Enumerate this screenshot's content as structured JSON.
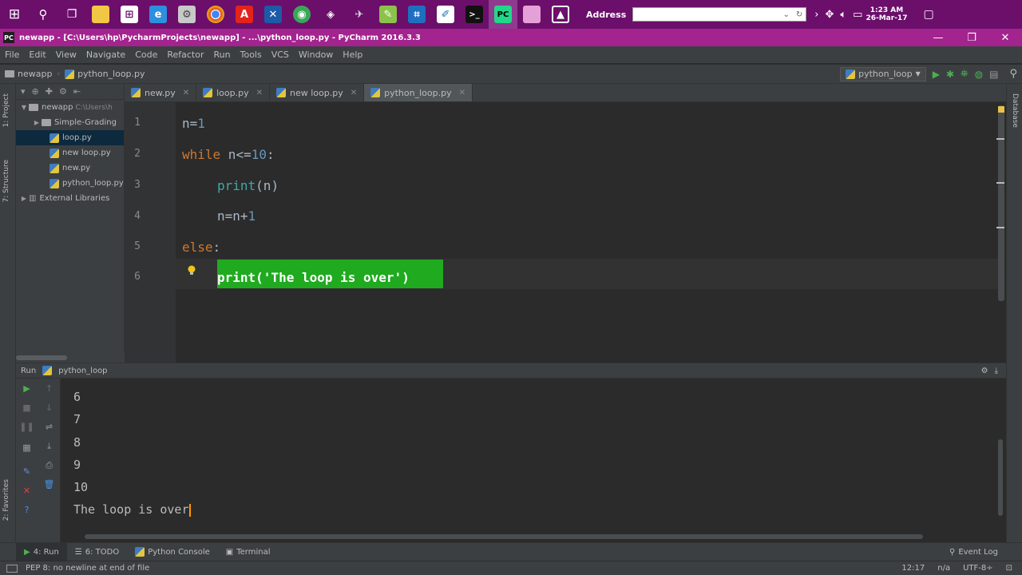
{
  "colors": {
    "taskbar": "#6b0f6b",
    "titlebar": "#a3238f",
    "ide_bg": "#2b2b2b",
    "panel_bg": "#3c3f41",
    "selection_highlight": "#1faa1f",
    "keyword": "#cc7832",
    "number": "#6897bb",
    "string": "#6a8759"
  },
  "taskbar": {
    "icons": [
      "windows-start-icon",
      "search-icon",
      "task-view-icon",
      "file-explorer-icon",
      "store-icon",
      "ie-icon",
      "settings-icon",
      "chrome-icon",
      "acrobat-icon",
      "network-icon",
      "android-icon",
      "unity-icon",
      "game-icon",
      "notepad-plus-icon",
      "screen-capture-icon",
      "pdf-edit-icon",
      "cmd-icon",
      "pycharm-icon",
      "paint-icon",
      "photos-icon"
    ],
    "address_label": "Address",
    "clock_time": "1:23 AM",
    "clock_date": "26-Mar-17"
  },
  "window": {
    "title": "newapp - [C:\\Users\\hp\\PycharmProjects\\newapp] - ...\\python_loop.py - PyCharm 2016.3.3"
  },
  "menu": [
    "File",
    "Edit",
    "View",
    "Navigate",
    "Code",
    "Refactor",
    "Run",
    "Tools",
    "VCS",
    "Window",
    "Help"
  ],
  "nav": {
    "project": "newapp",
    "file": "python_loop.py",
    "run_config": "python_loop"
  },
  "tool_stripe": {
    "project": "1: Project",
    "structure": "7: Structure",
    "favorites": "2: Favorites",
    "database": "Database"
  },
  "project_tree": [
    {
      "label": "newapp",
      "extra": "C:\\Users\\h",
      "depth": 0,
      "kind": "folder",
      "open": true
    },
    {
      "label": "Simple-Grading",
      "depth": 1,
      "kind": "folder",
      "open": false
    },
    {
      "label": "loop.py",
      "depth": 2,
      "kind": "py",
      "selected": true
    },
    {
      "label": "new loop.py",
      "depth": 2,
      "kind": "py"
    },
    {
      "label": "new.py",
      "depth": 2,
      "kind": "py"
    },
    {
      "label": "python_loop.py",
      "depth": 2,
      "kind": "py"
    },
    {
      "label": "External Libraries",
      "depth": 0,
      "kind": "lib",
      "open": false
    }
  ],
  "editor_tabs": [
    {
      "label": "new.py",
      "active": false
    },
    {
      "label": "loop.py",
      "active": false
    },
    {
      "label": "new loop.py",
      "active": false
    },
    {
      "label": "python_loop.py",
      "active": true
    }
  ],
  "code_lines": [
    "1",
    "2",
    "3",
    "4",
    "5",
    "6"
  ],
  "code": {
    "l1": {
      "a": "n=",
      "b": "1"
    },
    "l2": {
      "a": "while",
      "b": " n<=",
      "c": "10",
      "d": ":"
    },
    "l3": {
      "a": "print",
      "b": "(n)"
    },
    "l4": {
      "a": "n=n+",
      "b": "1"
    },
    "l5": {
      "a": "else",
      "b": ":"
    },
    "l6": {
      "a": "print('The loop is over')"
    }
  },
  "run_panel": {
    "tab": "Run",
    "config": "python_loop"
  },
  "console_output": [
    "6",
    "7",
    "8",
    "9",
    "10",
    "The loop is over"
  ],
  "bottom_tools": [
    {
      "label": "4: Run",
      "active": true
    },
    {
      "label": "6: TODO",
      "active": false
    },
    {
      "label": "Python Console",
      "active": false
    },
    {
      "label": "Terminal",
      "active": false
    }
  ],
  "event_log": "Event Log",
  "status": {
    "message": "PEP 8: no newline at end of file",
    "position": "12:17",
    "line_sep": "n/a",
    "encoding": "UTF-8÷"
  }
}
